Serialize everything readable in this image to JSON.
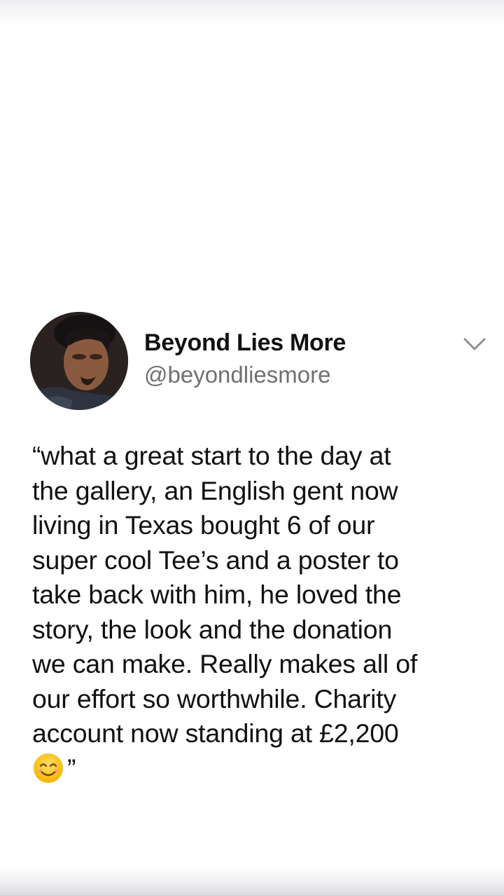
{
  "tweet": {
    "display_name": "Beyond Lies More",
    "handle": "@beyondliesmore",
    "avatar_icon": "profile-photo-avatar",
    "menu_icon": "chevron-down-icon",
    "body_lines": [
      "“what a great start to the day at",
      "the gallery, an English gent now",
      "living in Texas bought 6 of our",
      "super cool Tee’s and a poster to",
      "take back with him, he loved the",
      "story, the look and the donation",
      "we can make. Really makes all of",
      "our effort so worthwhile. Charity",
      "account now standing at £2,200"
    ],
    "emoji_icon": "smiling-face-icon",
    "closing_quote": "”"
  },
  "colors": {
    "name": "#111111",
    "handle": "#6f6f74",
    "chevron": "#8e8e93",
    "background": "#ffffff"
  }
}
